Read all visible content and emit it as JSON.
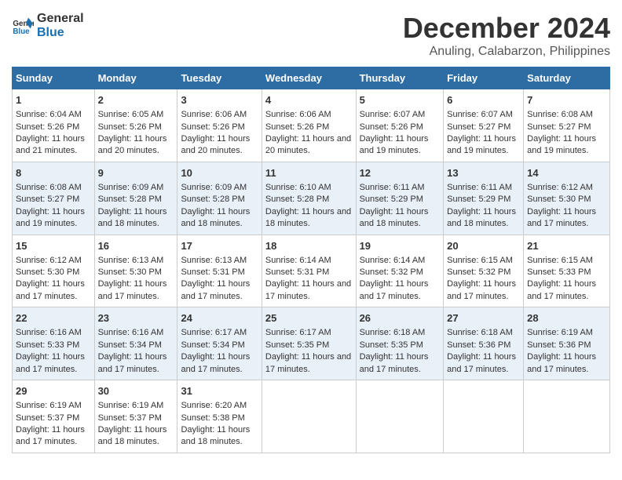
{
  "logo": {
    "text_general": "General",
    "text_blue": "Blue"
  },
  "title": "December 2024",
  "subtitle": "Anuling, Calabarzon, Philippines",
  "days_of_week": [
    "Sunday",
    "Monday",
    "Tuesday",
    "Wednesday",
    "Thursday",
    "Friday",
    "Saturday"
  ],
  "weeks": [
    [
      {
        "day": "1",
        "sunrise": "Sunrise: 6:04 AM",
        "sunset": "Sunset: 5:26 PM",
        "daylight": "Daylight: 11 hours and 21 minutes."
      },
      {
        "day": "2",
        "sunrise": "Sunrise: 6:05 AM",
        "sunset": "Sunset: 5:26 PM",
        "daylight": "Daylight: 11 hours and 20 minutes."
      },
      {
        "day": "3",
        "sunrise": "Sunrise: 6:06 AM",
        "sunset": "Sunset: 5:26 PM",
        "daylight": "Daylight: 11 hours and 20 minutes."
      },
      {
        "day": "4",
        "sunrise": "Sunrise: 6:06 AM",
        "sunset": "Sunset: 5:26 PM",
        "daylight": "Daylight: 11 hours and 20 minutes."
      },
      {
        "day": "5",
        "sunrise": "Sunrise: 6:07 AM",
        "sunset": "Sunset: 5:26 PM",
        "daylight": "Daylight: 11 hours and 19 minutes."
      },
      {
        "day": "6",
        "sunrise": "Sunrise: 6:07 AM",
        "sunset": "Sunset: 5:27 PM",
        "daylight": "Daylight: 11 hours and 19 minutes."
      },
      {
        "day": "7",
        "sunrise": "Sunrise: 6:08 AM",
        "sunset": "Sunset: 5:27 PM",
        "daylight": "Daylight: 11 hours and 19 minutes."
      }
    ],
    [
      {
        "day": "8",
        "sunrise": "Sunrise: 6:08 AM",
        "sunset": "Sunset: 5:27 PM",
        "daylight": "Daylight: 11 hours and 19 minutes."
      },
      {
        "day": "9",
        "sunrise": "Sunrise: 6:09 AM",
        "sunset": "Sunset: 5:28 PM",
        "daylight": "Daylight: 11 hours and 18 minutes."
      },
      {
        "day": "10",
        "sunrise": "Sunrise: 6:09 AM",
        "sunset": "Sunset: 5:28 PM",
        "daylight": "Daylight: 11 hours and 18 minutes."
      },
      {
        "day": "11",
        "sunrise": "Sunrise: 6:10 AM",
        "sunset": "Sunset: 5:28 PM",
        "daylight": "Daylight: 11 hours and 18 minutes."
      },
      {
        "day": "12",
        "sunrise": "Sunrise: 6:11 AM",
        "sunset": "Sunset: 5:29 PM",
        "daylight": "Daylight: 11 hours and 18 minutes."
      },
      {
        "day": "13",
        "sunrise": "Sunrise: 6:11 AM",
        "sunset": "Sunset: 5:29 PM",
        "daylight": "Daylight: 11 hours and 18 minutes."
      },
      {
        "day": "14",
        "sunrise": "Sunrise: 6:12 AM",
        "sunset": "Sunset: 5:30 PM",
        "daylight": "Daylight: 11 hours and 17 minutes."
      }
    ],
    [
      {
        "day": "15",
        "sunrise": "Sunrise: 6:12 AM",
        "sunset": "Sunset: 5:30 PM",
        "daylight": "Daylight: 11 hours and 17 minutes."
      },
      {
        "day": "16",
        "sunrise": "Sunrise: 6:13 AM",
        "sunset": "Sunset: 5:30 PM",
        "daylight": "Daylight: 11 hours and 17 minutes."
      },
      {
        "day": "17",
        "sunrise": "Sunrise: 6:13 AM",
        "sunset": "Sunset: 5:31 PM",
        "daylight": "Daylight: 11 hours and 17 minutes."
      },
      {
        "day": "18",
        "sunrise": "Sunrise: 6:14 AM",
        "sunset": "Sunset: 5:31 PM",
        "daylight": "Daylight: 11 hours and 17 minutes."
      },
      {
        "day": "19",
        "sunrise": "Sunrise: 6:14 AM",
        "sunset": "Sunset: 5:32 PM",
        "daylight": "Daylight: 11 hours and 17 minutes."
      },
      {
        "day": "20",
        "sunrise": "Sunrise: 6:15 AM",
        "sunset": "Sunset: 5:32 PM",
        "daylight": "Daylight: 11 hours and 17 minutes."
      },
      {
        "day": "21",
        "sunrise": "Sunrise: 6:15 AM",
        "sunset": "Sunset: 5:33 PM",
        "daylight": "Daylight: 11 hours and 17 minutes."
      }
    ],
    [
      {
        "day": "22",
        "sunrise": "Sunrise: 6:16 AM",
        "sunset": "Sunset: 5:33 PM",
        "daylight": "Daylight: 11 hours and 17 minutes."
      },
      {
        "day": "23",
        "sunrise": "Sunrise: 6:16 AM",
        "sunset": "Sunset: 5:34 PM",
        "daylight": "Daylight: 11 hours and 17 minutes."
      },
      {
        "day": "24",
        "sunrise": "Sunrise: 6:17 AM",
        "sunset": "Sunset: 5:34 PM",
        "daylight": "Daylight: 11 hours and 17 minutes."
      },
      {
        "day": "25",
        "sunrise": "Sunrise: 6:17 AM",
        "sunset": "Sunset: 5:35 PM",
        "daylight": "Daylight: 11 hours and 17 minutes."
      },
      {
        "day": "26",
        "sunrise": "Sunrise: 6:18 AM",
        "sunset": "Sunset: 5:35 PM",
        "daylight": "Daylight: 11 hours and 17 minutes."
      },
      {
        "day": "27",
        "sunrise": "Sunrise: 6:18 AM",
        "sunset": "Sunset: 5:36 PM",
        "daylight": "Daylight: 11 hours and 17 minutes."
      },
      {
        "day": "28",
        "sunrise": "Sunrise: 6:19 AM",
        "sunset": "Sunset: 5:36 PM",
        "daylight": "Daylight: 11 hours and 17 minutes."
      }
    ],
    [
      {
        "day": "29",
        "sunrise": "Sunrise: 6:19 AM",
        "sunset": "Sunset: 5:37 PM",
        "daylight": "Daylight: 11 hours and 17 minutes."
      },
      {
        "day": "30",
        "sunrise": "Sunrise: 6:19 AM",
        "sunset": "Sunset: 5:37 PM",
        "daylight": "Daylight: 11 hours and 18 minutes."
      },
      {
        "day": "31",
        "sunrise": "Sunrise: 6:20 AM",
        "sunset": "Sunset: 5:38 PM",
        "daylight": "Daylight: 11 hours and 18 minutes."
      },
      null,
      null,
      null,
      null
    ]
  ]
}
